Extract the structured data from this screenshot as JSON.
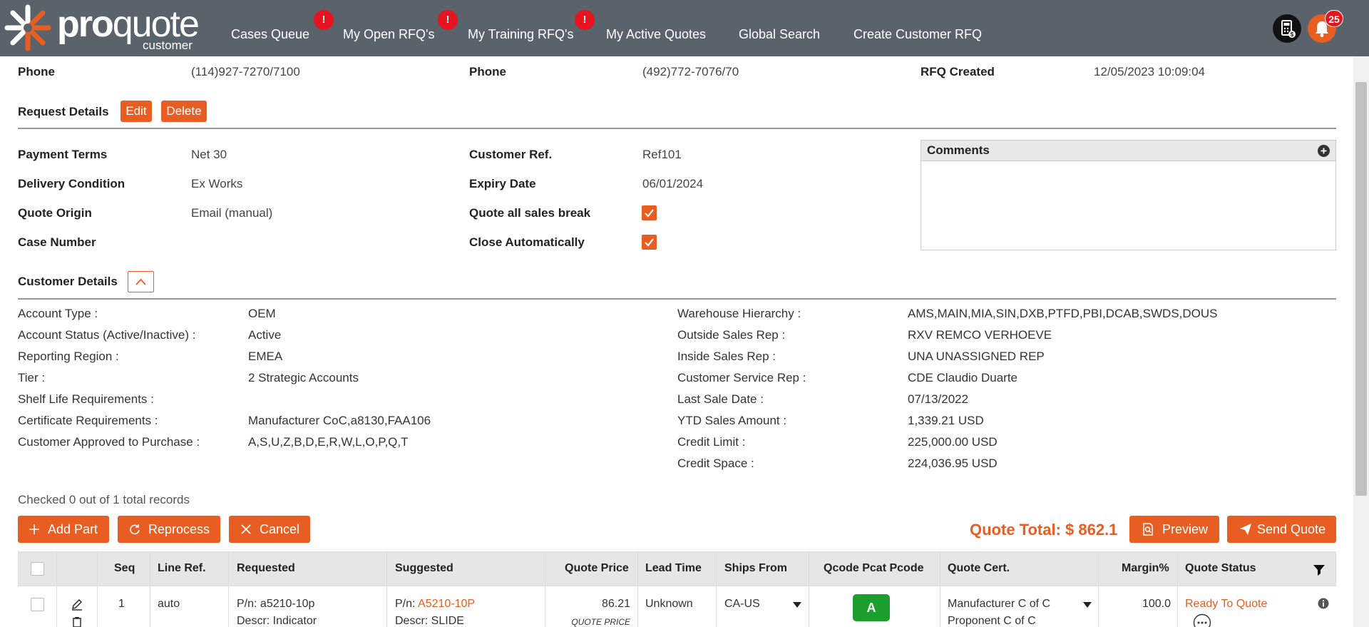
{
  "nav": {
    "logo_main": "pro",
    "logo_light": "quote",
    "logo_sub": "customer",
    "links": [
      "Cases Queue",
      "My Open RFQ's",
      "My Training RFQ's",
      "My Active Quotes",
      "Global Search",
      "Create Customer RFQ"
    ],
    "badge": "!",
    "notification_count": "25"
  },
  "top_row": {
    "phone1_label": "Phone",
    "phone1": "(114)927-7270/7100",
    "phone2_label": "Phone",
    "phone2": "(492)772-7076/70",
    "created_label": "RFQ Created",
    "created": "12/05/2023 10:09:04"
  },
  "request": {
    "title": "Request Details",
    "edit": "Edit",
    "delete": "Delete",
    "payment_terms_label": "Payment Terms",
    "payment_terms": "Net 30",
    "delivery_label": "Delivery Condition",
    "delivery": "Ex Works",
    "origin_label": "Quote Origin",
    "origin": "Email (manual)",
    "case_label": "Case Number",
    "cust_ref_label": "Customer Ref.",
    "cust_ref": "Ref101",
    "expiry_label": "Expiry Date",
    "expiry": "06/01/2024",
    "sales_break_label": "Quote all sales break",
    "close_auto_label": "Close Automatically",
    "comments_title": "Comments"
  },
  "customer": {
    "title": "Customer Details",
    "left": [
      {
        "label": "Account Type",
        "value": "OEM"
      },
      {
        "label": "Account Status (Active/Inactive)",
        "value": "Active"
      },
      {
        "label": "Reporting Region",
        "value": "EMEA"
      },
      {
        "label": "Tier",
        "value": "2 Strategic Accounts"
      },
      {
        "label": "Shelf Life Requirements",
        "value": ""
      },
      {
        "label": "Certificate Requirements",
        "value": "Manufacturer CoC,a8130,FAA106"
      },
      {
        "label": "Customer Approved to Purchase",
        "value": "A,S,U,Z,B,D,E,R,W,L,O,P,Q,T"
      }
    ],
    "right": [
      {
        "label": "Warehouse Hierarchy",
        "value": "AMS,MAIN,MIA,SIN,DXB,PTFD,PBI,DCAB,SWDS,DOUS"
      },
      {
        "label": "Outside Sales Rep",
        "value": "RXV REMCO VERHOEVE"
      },
      {
        "label": "Inside Sales Rep",
        "value": "UNA UNASSIGNED REP"
      },
      {
        "label": "Customer Service Rep",
        "value": "CDE Claudio Duarte"
      },
      {
        "label": "Last Sale Date",
        "value": "07/13/2022"
      },
      {
        "label": "YTD Sales Amount",
        "value": "1,339.21 USD"
      },
      {
        "label": "Credit Limit",
        "value": "225,000.00 USD"
      },
      {
        "label": "Credit Space",
        "value": "224,036.95 USD"
      }
    ]
  },
  "records": {
    "checked": "Checked 0 out of 1 total records",
    "add_part": "Add Part",
    "reprocess": "Reprocess",
    "cancel": "Cancel",
    "quote_total": "Quote Total: $ 862.1",
    "preview": "Preview",
    "send_quote": "Send Quote"
  },
  "table": {
    "headers": [
      "Seq",
      "Line Ref.",
      "Requested",
      "Suggested",
      "Quote Price",
      "Lead Time",
      "Ships From",
      "Qcode Pcat Pcode",
      "Quote Cert.",
      "Margin%",
      "Quote Status"
    ],
    "row": {
      "seq": "1",
      "line_ref": "auto",
      "req_pn_label": "P/n:",
      "req_pn": "a5210-10p",
      "req_descr": "Descr: Indicator",
      "sug_pn_label": "P/n:",
      "sug_pn": "A5210-10P",
      "sug_descr": "Descr: SLIDE",
      "price": "86.21",
      "price_note": "QUOTE PRICE",
      "lead": "Unknown",
      "ships": "CA-US",
      "grade": "A",
      "cert1": "Manufacturer C of C",
      "cert2": "Proponent C of C",
      "margin": "100.0",
      "status": "Ready To Quote"
    }
  }
}
